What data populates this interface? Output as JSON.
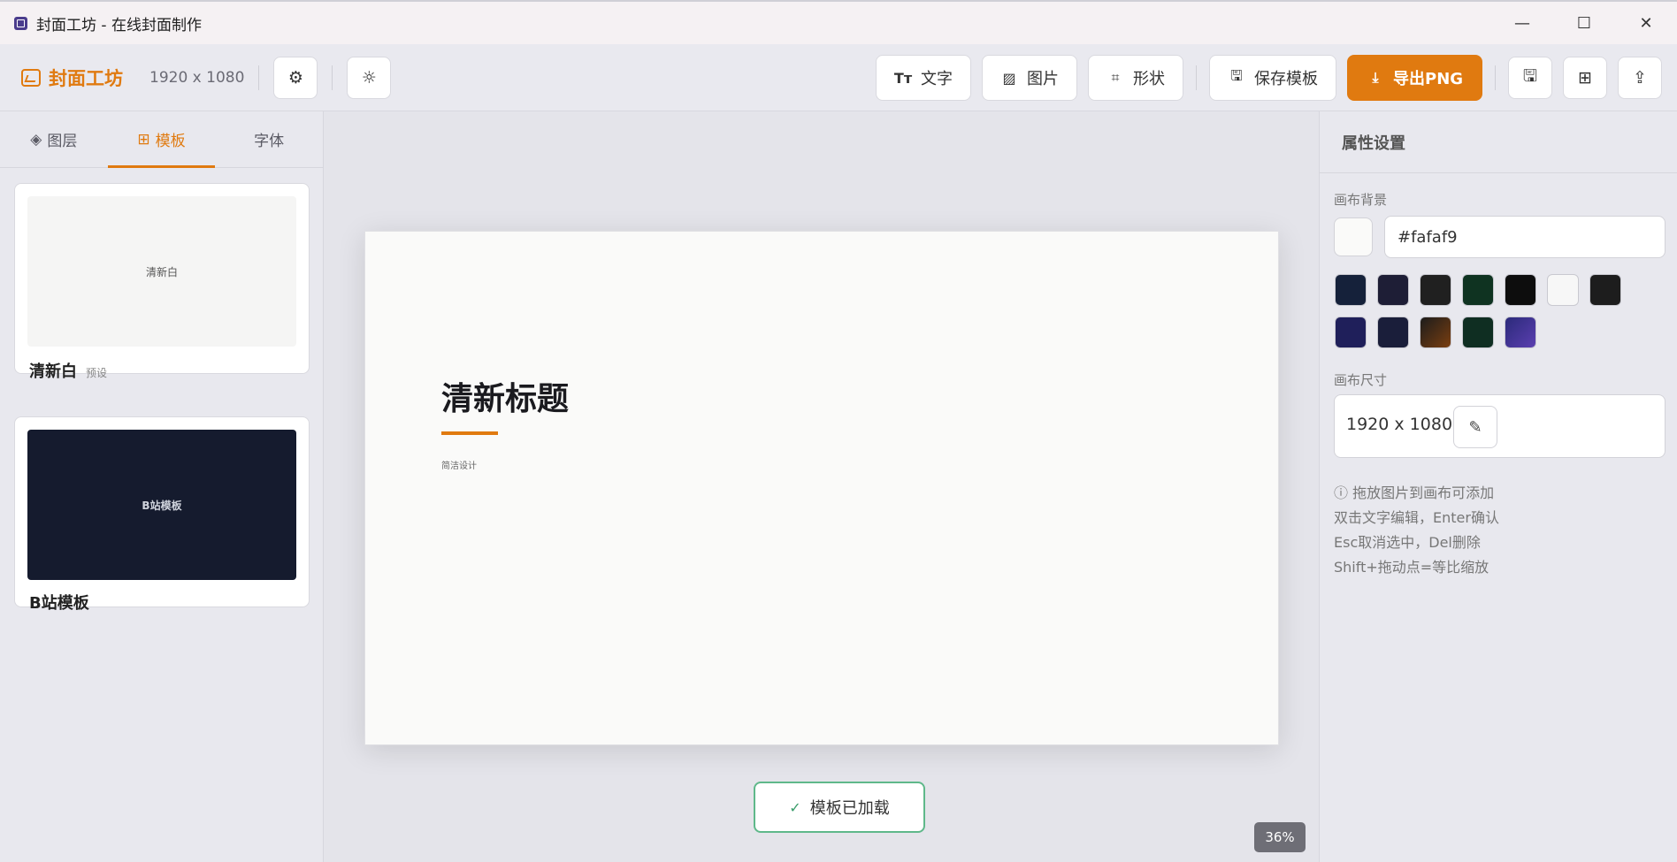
{
  "window": {
    "title": "封面工坊 - 在线封面制作",
    "controls": {
      "minimize": "—",
      "maximize": "☐",
      "close": "✕"
    }
  },
  "toolbar": {
    "brand_name": "封面工坊",
    "canvas_size": "1920 x 1080",
    "text_label": "文字",
    "image_label": "图片",
    "shape_label": "形状",
    "save_template_label": "保存模板",
    "export_label": "导出PNG",
    "accent_color": "#e07a10"
  },
  "left_panel": {
    "tabs": [
      {
        "label": "图层",
        "icon": "layers-icon"
      },
      {
        "label": "模板",
        "icon": "grid-icon",
        "active": true
      },
      {
        "label": "字体"
      }
    ],
    "templates": [
      {
        "name": "清新白",
        "tag": "预设",
        "preview_text": "清新白",
        "preview_bg": "#f5f5f4",
        "preview_color": "#555555"
      },
      {
        "name": "B站模板",
        "tag": "",
        "preview_text": "B站模板",
        "preview_bg": "#151b2e",
        "preview_color": "#cfd3dc"
      }
    ]
  },
  "canvas": {
    "background": "#fafaf9",
    "title": "清新标题",
    "subtitle": "简洁设计",
    "zoom": "36%"
  },
  "toast": {
    "message": "模板已加载"
  },
  "right_panel": {
    "header": "属性设置",
    "bg_label": "画布背景",
    "bg_value": "#fafaf9",
    "swatches_row1": [
      "#15213a",
      "#1e1e36",
      "#202020",
      "#0f3321",
      "#0d0d0d",
      "#f7f7f7",
      "#1d1d1d"
    ],
    "swatches_row2": [
      "#1f1f5a",
      "#1a1e3a",
      "#5a3210",
      "#0f2e22",
      "#3d2f8f"
    ],
    "size_label": "画布尺寸",
    "size_value": "1920 x 1080",
    "tips": [
      "拖放图片到画布可添加",
      "双击文字编辑，Enter确认",
      "Esc取消选中，Del删除",
      "Shift+拖动点=等比缩放"
    ]
  }
}
